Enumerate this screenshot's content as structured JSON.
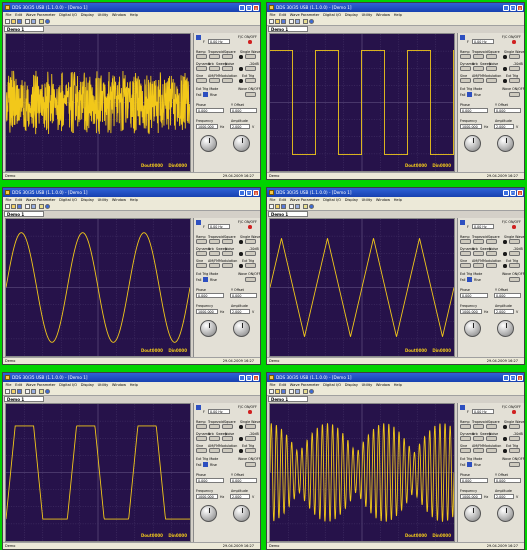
{
  "app": {
    "window_title": "DDS 30/35 USB  (1.1.0.0)  - [Demo 1]",
    "document_tab": "Demo 1",
    "menu": [
      "File",
      "Edit",
      "Wave Parameter",
      "Digital I/O",
      "Display",
      "Utility",
      "Window",
      "Help"
    ],
    "toolbar_icons": [
      "new-icon",
      "open-icon",
      "save-icon",
      "print-icon",
      "settings-icon",
      "help-icon",
      "info-icon"
    ]
  },
  "panel": {
    "onoff_label": "F/C ON/OFF",
    "freq_value": "0.00 Hz",
    "freq_small": "F",
    "buttons_row1": [
      "Ramp",
      "Trapezoid",
      "Square",
      "Single Wave"
    ],
    "buttons_row2": [
      "Dynamic",
      "Arb",
      "Sweep",
      "Noise",
      "-20dB"
    ],
    "buttons_row3": [
      "Sine",
      "AM/FM",
      "Modulation",
      "Ext Trig"
    ],
    "ext_trig_mode": "Ext Trig Mode",
    "wave_on_off": "Wave ON/OFF",
    "fall_label": "Fall",
    "rise_label": "Rise",
    "phase_label": "Phase",
    "phase_value": "0.000",
    "offset_label": "Y Offset",
    "offset_value": "0.000",
    "frequency_label": "Frequency",
    "frequency_value": "1000.000",
    "frequency_unit": "Hz",
    "amplitude_label": "Amplitude",
    "amplitude_value": "2.000",
    "amplitude_unit": "V"
  },
  "scope_overlay": {
    "left": "Dout0000",
    "right": "Din0000"
  },
  "status": {
    "left": "Demo",
    "right": "29.04.2009  16:27"
  },
  "colors": {
    "screen_bg": "#26124a",
    "trace": "#f2c81a",
    "grid": "#6a5a8a",
    "desktop": "#00d400"
  },
  "windows": [
    {
      "waveform": "noise"
    },
    {
      "waveform": "square"
    },
    {
      "waveform": "sine"
    },
    {
      "waveform": "triangle"
    },
    {
      "waveform": "trapezoid"
    },
    {
      "waveform": "am"
    }
  ]
}
